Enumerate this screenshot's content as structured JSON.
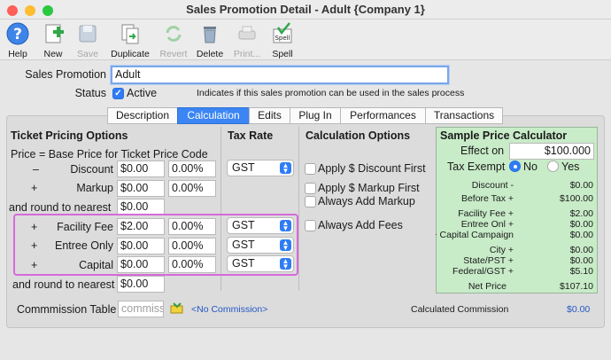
{
  "window": {
    "title": "Sales Promotion Detail - Adult {Company 1}"
  },
  "toolbar": {
    "help": "Help",
    "new": "New",
    "save": "Save",
    "duplicate": "Duplicate",
    "revert": "Revert",
    "delete": "Delete",
    "print": "Print...",
    "spell": "Spell",
    "spell_icon_text": "Spell"
  },
  "form": {
    "sales_promotion_label": "Sales Promotion",
    "sales_promotion_value": "Adult",
    "status_label": "Status",
    "active_label": "Active",
    "status_hint": "Indicates if this sales promotion can be used in the sales process"
  },
  "tabs": [
    "Description",
    "Calculation",
    "Edits",
    "Plug In",
    "Performances",
    "Transactions"
  ],
  "pricing": {
    "header": "Ticket Pricing Options",
    "tax_header": "Tax Rate",
    "formula": "Price = Base Price for Ticket Price Code",
    "discount_sign": "–",
    "discount_label": "Discount",
    "discount_amount": "$0.00",
    "discount_pct": "0.00%",
    "markup_sign": "+",
    "markup_label": "Markup",
    "markup_amount": "$0.00",
    "markup_pct": "0.00%",
    "round1_label": "and round to nearest",
    "round1_value": "$0.00",
    "facility_sign": "+",
    "facility_label": "Facility Fee",
    "facility_amount": "$2.00",
    "facility_pct": "0.00%",
    "entree_sign": "+",
    "entree_label": "Entree Only",
    "entree_amount": "$0.00",
    "entree_pct": "0.00%",
    "capital_sign": "+",
    "capital_label": "Capital",
    "capital_amount": "$0.00",
    "capital_pct": "0.00%",
    "round2_label": "and round to nearest",
    "round2_value": "$0.00",
    "tax_discount": "GST",
    "tax_facility": "GST",
    "tax_entree": "GST",
    "tax_capital": "GST"
  },
  "calc_options": {
    "header": "Calculation Options",
    "apply_discount_first": "Apply $ Discount First",
    "apply_markup_first": "Apply $ Markup First",
    "always_add_markup": "Always Add Markup",
    "always_add_fees": "Always Add Fees"
  },
  "sample": {
    "header": "Sample Price Calculator",
    "effect_on_label": "Effect on",
    "effect_on_value": "$100.000",
    "tax_exempt_label": "Tax Exempt",
    "no_label": "No",
    "yes_label": "Yes",
    "rows": [
      {
        "label": "Discount -",
        "value": "$0.00"
      },
      {
        "label": "Before Tax +",
        "value": "$100.00"
      },
      {
        "label": "Facility Fee +",
        "value": "$2.00"
      },
      {
        "label": "Entree Onl +",
        "value": "$0.00"
      },
      {
        "label": "Capital Campaign +",
        "value": "$0.00"
      },
      {
        "label": "City +",
        "value": "$0.00"
      },
      {
        "label": "State/PST +",
        "value": "$0.00"
      },
      {
        "label": "Federal/GST +",
        "value": "$5.10"
      },
      {
        "label": "Net Price",
        "value": "$107.10"
      }
    ]
  },
  "commission": {
    "label": "Commmission Table",
    "placeholder": "commission",
    "no_commission": "<No Commission>",
    "calculated_label": "Calculated Commission",
    "calculated_value": "$0.00"
  }
}
